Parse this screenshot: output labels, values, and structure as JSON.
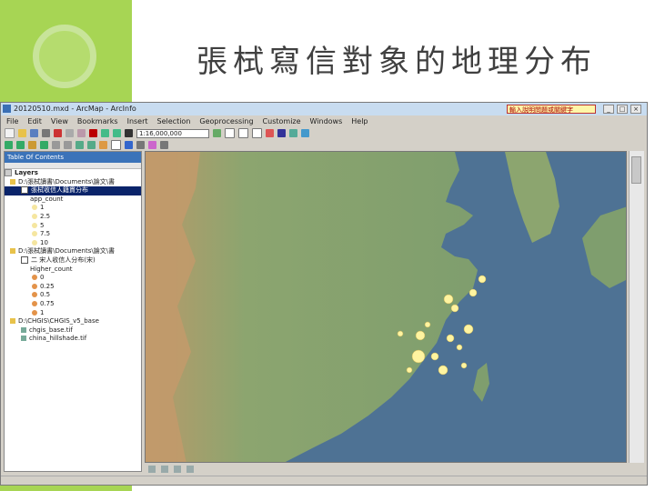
{
  "slide": {
    "title": "張栻寫信對象的地理分布"
  },
  "app": {
    "window_title": "20120510.mxd - ArcMap - ArcInfo",
    "help_box": "輸入說明問題或關鍵字",
    "menu": [
      "File",
      "Edit",
      "View",
      "Bookmarks",
      "Insert",
      "Selection",
      "Geoprocessing",
      "Customize",
      "Windows",
      "Help"
    ],
    "scale_value": "1:16,000,000"
  },
  "toc": {
    "header": "Table Of Contents",
    "root_label": "Layers",
    "rows": [
      {
        "label": "D:\\張栻讀書\\Documents\\論文\\書",
        "kind": "folder"
      },
      {
        "label": "張栻收信人籍貫分布",
        "kind": "selected"
      },
      {
        "label": "app_count",
        "kind": "field"
      },
      {
        "label": "1",
        "kind": "legend",
        "color": "#f5e6a0"
      },
      {
        "label": "2.5",
        "kind": "legend",
        "color": "#f5e6a0"
      },
      {
        "label": "5",
        "kind": "legend",
        "color": "#f5e6a0"
      },
      {
        "label": "7.5",
        "kind": "legend",
        "color": "#f5e6a0"
      },
      {
        "label": "10",
        "kind": "legend",
        "color": "#f5e6a0"
      },
      {
        "label": "D:\\張栻讀書\\Documents\\論文\\書",
        "kind": "folder"
      },
      {
        "label": "二 宋人收信人分布(宋)",
        "kind": "layer"
      },
      {
        "label": "Higher_count",
        "kind": "field"
      },
      {
        "label": "0",
        "kind": "legend",
        "color": "#e3934a"
      },
      {
        "label": "0.25",
        "kind": "legend",
        "color": "#e3934a"
      },
      {
        "label": "0.5",
        "kind": "legend",
        "color": "#e3934a"
      },
      {
        "label": "0.75",
        "kind": "legend",
        "color": "#e3934a"
      },
      {
        "label": "1",
        "kind": "legend",
        "color": "#e3934a"
      },
      {
        "label": "D:\\CHGIS\\CHGIS_v5_base",
        "kind": "folder"
      },
      {
        "label": "chgis_base.tif",
        "kind": "raster"
      },
      {
        "label": "china_hillshade.tif",
        "kind": "raster"
      }
    ]
  },
  "colors": {
    "slide_green": "#8cc63f",
    "slide_light_green": "#a7d554",
    "map_land": "#8fa57a",
    "map_sea": "#4e7294",
    "point_yellow": "#fff4a0"
  },
  "icons": [
    "app-icon",
    "folder-icon",
    "layer-icon",
    "zoom-icon",
    "pan-icon",
    "identify-icon"
  ]
}
